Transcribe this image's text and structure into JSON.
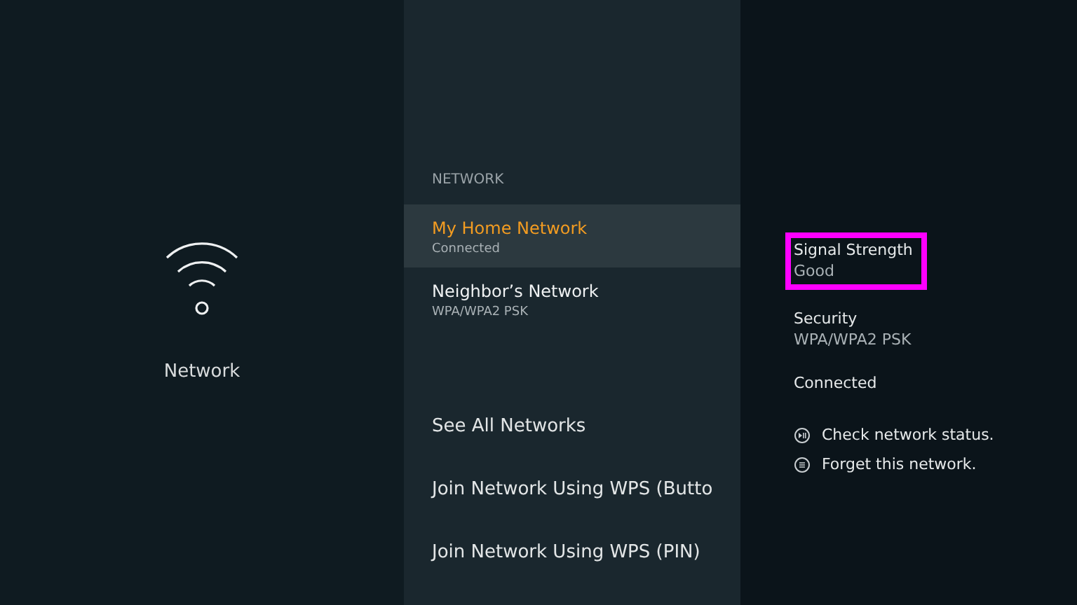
{
  "category": {
    "label": "Network"
  },
  "list": {
    "header": "NETWORK",
    "networks": [
      {
        "name": "My Home Network",
        "status": "Connected",
        "selected": true
      },
      {
        "name": "Neighbor’s Network",
        "status": "WPA/WPA2 PSK",
        "selected": false
      }
    ],
    "options": [
      "See All Networks",
      "Join Network Using WPS (Butto",
      "Join Network Using WPS (PIN)"
    ]
  },
  "details": {
    "fields": [
      {
        "label": "Signal Strength",
        "value": "Good",
        "highlighted": true
      },
      {
        "label": "Security",
        "value": "WPA/WPA2 PSK",
        "highlighted": false
      }
    ],
    "status": "Connected",
    "actions": [
      {
        "kind": "play",
        "label": "Check network status."
      },
      {
        "kind": "menu",
        "label": "Forget this network."
      }
    ]
  }
}
